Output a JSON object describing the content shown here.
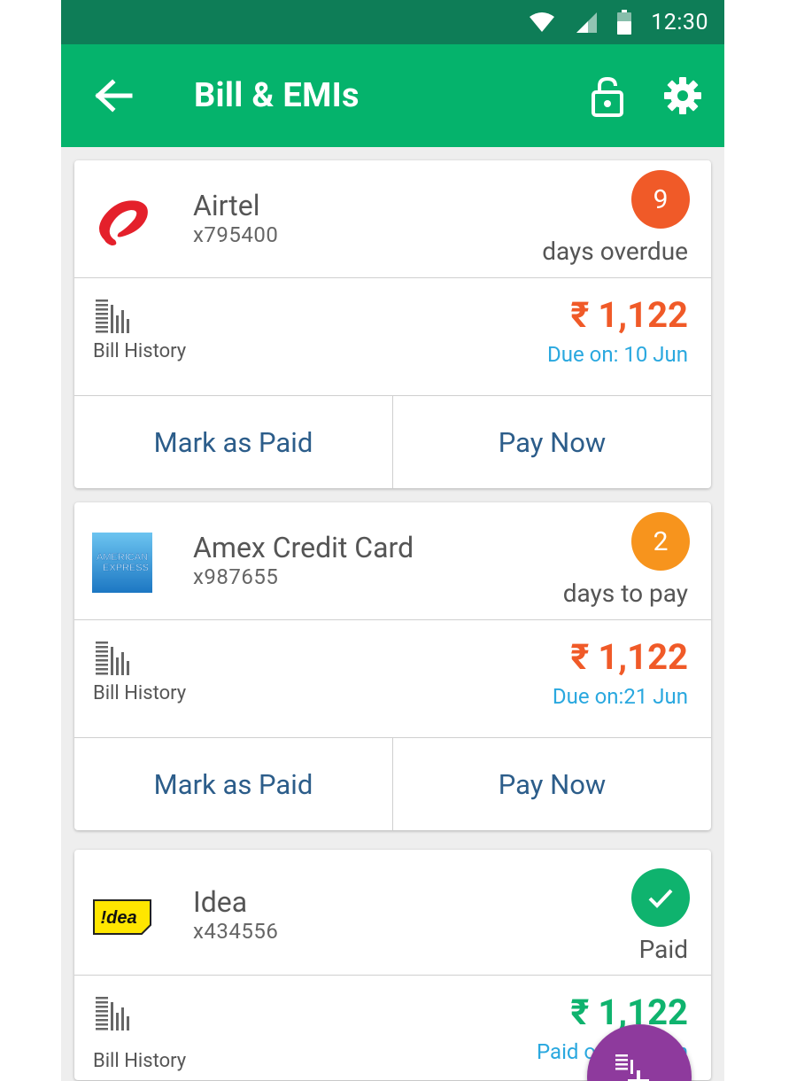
{
  "status_bar": {
    "time": "12:30"
  },
  "app_bar": {
    "title": "Bill & EMIs"
  },
  "bills": [
    {
      "name": "Airtel",
      "account": "x795400",
      "badge": "9",
      "badge_color": "#f05a28",
      "status": "days overdue",
      "history_label": "Bill History",
      "amount": "₹ 1,122",
      "amount_color": "#f05a28",
      "due": "Due on: 10 Jun",
      "actions": [
        "Mark as Paid",
        "Pay Now"
      ]
    },
    {
      "name": "Amex Credit Card",
      "account": "x987655",
      "badge": "2",
      "badge_color": "#f7941d",
      "status": "days to pay",
      "history_label": "Bill History",
      "amount": "₹ 1,122",
      "amount_color": "#f05a28",
      "due": "Due on:21 Jun",
      "actions": [
        "Mark as Paid",
        "Pay Now"
      ]
    },
    {
      "name": "Idea",
      "account": "x434556",
      "badge": "✓",
      "badge_color": "#0fb36e",
      "status": "Paid",
      "history_label": "Bill History",
      "amount": "₹ 1,122",
      "amount_color": "#0fb36e",
      "due": "Paid o",
      "due_tail": "n"
    }
  ],
  "logos": {
    "amex_line1": "AMERICAN",
    "amex_line2": "EXPRESS",
    "idea": "!dea"
  },
  "colors": {
    "status_bar": "#0e7d57",
    "app_bar": "#05b36c",
    "fab": "#8e3a9d",
    "link_blue": "#2c5d8a",
    "due_blue": "#2aa8df"
  }
}
